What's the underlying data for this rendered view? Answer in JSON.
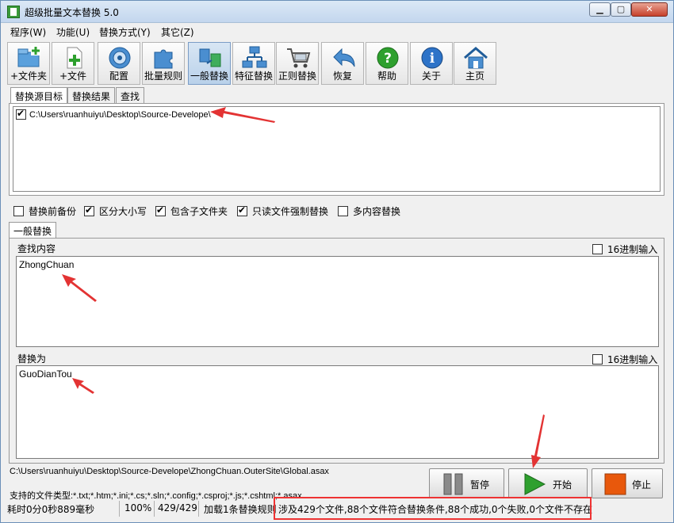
{
  "window": {
    "title": "超级批量文本替换 5.0",
    "min_glyph": "▁",
    "max_glyph": "▢",
    "close_glyph": "✕"
  },
  "menu": [
    {
      "label": "程序(W)"
    },
    {
      "label": "功能(U)"
    },
    {
      "label": "替换方式(Y)"
    },
    {
      "label": "其它(Z)"
    }
  ],
  "toolbar": {
    "add_folder": "+文件夹",
    "add_file": "+文件",
    "config": "配置",
    "batch_rules": "批量规则",
    "general_replace": "一般替换",
    "feature_replace": "特征替换",
    "regex_replace": "正则替换",
    "restore": "恢复",
    "help": "帮助",
    "about": "关于",
    "home": "主页"
  },
  "tabs": {
    "source": "替换源目标",
    "result": "替换结果",
    "find": "查找"
  },
  "source_list": [
    {
      "checked": true,
      "path": "C:\\Users\\ruanhuiyu\\Desktop\\Source-Develope\\"
    }
  ],
  "options": {
    "backup": {
      "label": "替换前备份",
      "checked": false
    },
    "case_sensitive": {
      "label": "区分大小写",
      "checked": true
    },
    "subfolders": {
      "label": "包含子文件夹",
      "checked": true
    },
    "readonly_force": {
      "label": "只读文件强制替换",
      "checked": true
    },
    "multi_content": {
      "label": "多内容替换",
      "checked": false
    }
  },
  "general_tab": "一般替换",
  "find": {
    "label": "查找内容",
    "hex_label": "16进制输入",
    "hex_checked": false,
    "value": "ZhongChuan"
  },
  "replace": {
    "label": "替换为",
    "hex_label": "16进制输入",
    "hex_checked": false,
    "value": "GuoDianTou"
  },
  "current_file": "C:\\Users\\ruanhuiyu\\Desktop\\Source-Develope\\ZhongChuan.OuterSite\\Global.asax",
  "file_types": "支持的文件类型:*.txt;*.htm;*.ini;*.cs;*.sln;*.config;*.csproj;*.js;*.cshtml;*.asax",
  "buttons": {
    "pause": "暂停",
    "start": "开始",
    "stop": "停止"
  },
  "status": {
    "elapsed": "耗时0分0秒889毫秒",
    "percent": "100%",
    "count": "429/429",
    "rules": "加载1条替换规则",
    "summary": "涉及429个文件,88个文件符合替换条件,88个成功,0个失败,0个文件不存在"
  },
  "colors": {
    "accent_red": "#e33333",
    "start_green": "#2ea02e",
    "stop_orange": "#e8580c"
  }
}
